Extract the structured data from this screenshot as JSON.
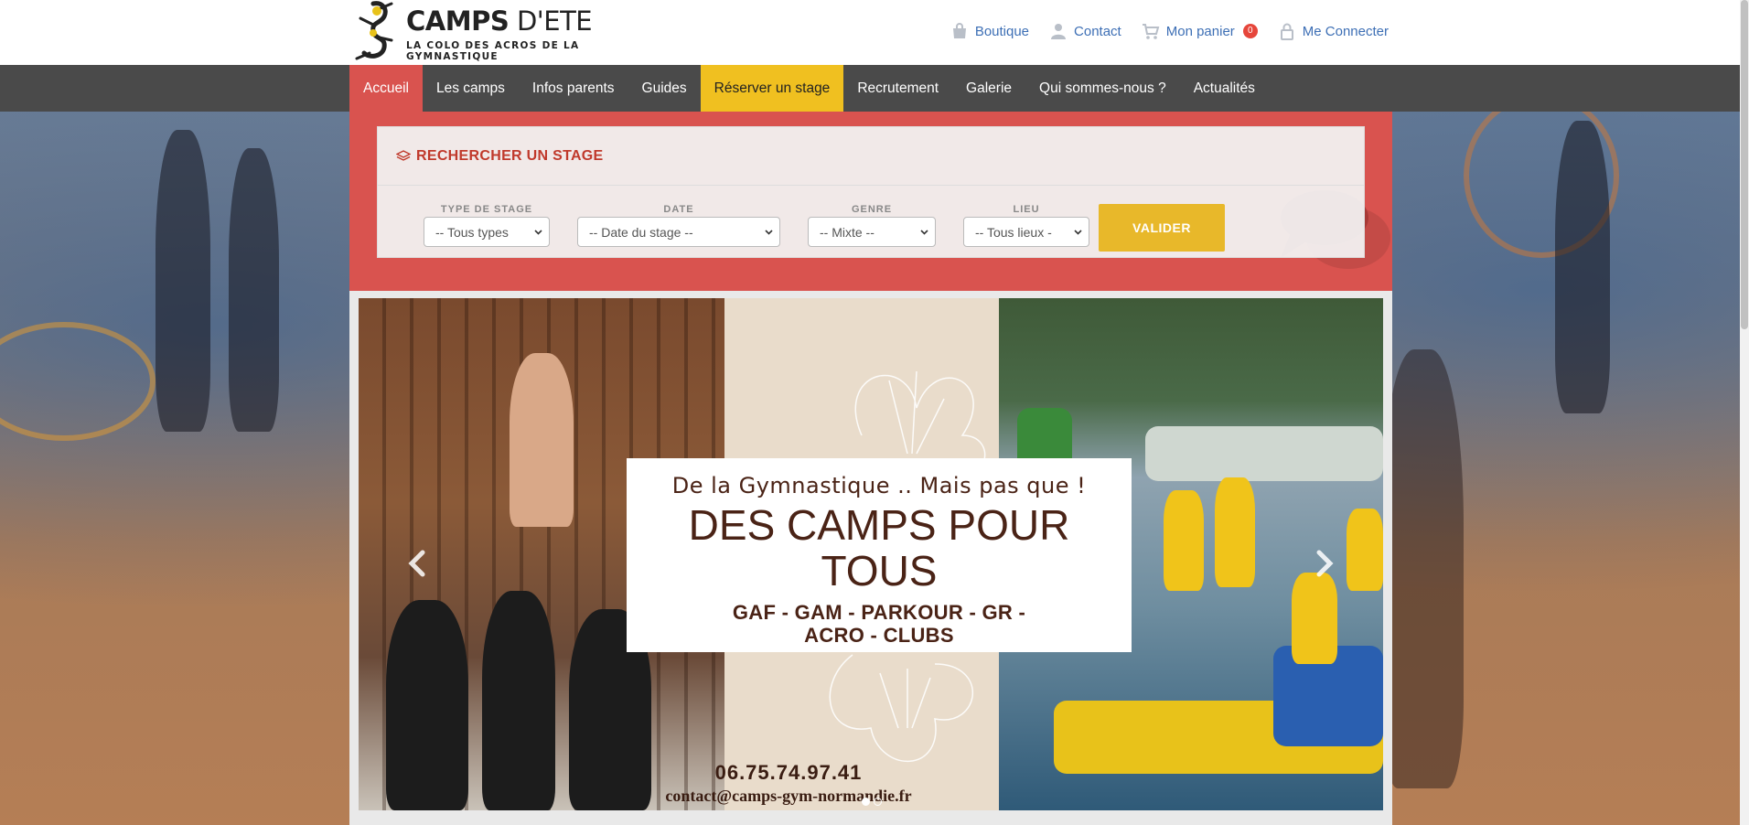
{
  "brand": {
    "title_bold": "CAMPS",
    "title_light": " D'ETE",
    "subtitle": "LA COLO DES ACROS DE LA GYMNASTIQUE"
  },
  "top_links": {
    "boutique": "Boutique",
    "contact": "Contact",
    "cart": "Mon panier",
    "cart_count": "0",
    "login": "Me Connecter"
  },
  "nav": {
    "items": [
      "Accueil",
      "Les camps",
      "Infos parents",
      "Guides",
      "Réserver un stage",
      "Recrutement",
      "Galerie",
      "Qui sommes-nous ?",
      "Actualités"
    ]
  },
  "search": {
    "title": "RECHERCHER UN STAGE",
    "filters": [
      {
        "label": "TYPE DE STAGE",
        "value": "-- Tous types"
      },
      {
        "label": "DATE",
        "value": "-- Date du stage --"
      },
      {
        "label": "GENRE",
        "value": "-- Mixte --"
      },
      {
        "label": "LIEU",
        "value": "-- Tous lieux -"
      }
    ],
    "submit": "VALIDER"
  },
  "slide": {
    "tagline": "De la Gymnastique .. Mais pas que !",
    "title_line1": "DES CAMPS POUR",
    "title_line2": "TOUS",
    "sub_line1": "GAF - GAM - PARKOUR - GR -",
    "sub_line2": "ACRO - CLUBS",
    "phone": "06.75.74.97.41",
    "email": "contact@camps-gym-normandie.fr"
  },
  "colors": {
    "nav_bg": "#4a4a4a",
    "nav_active": "#d9534f",
    "nav_highlight": "#f0c020",
    "link": "#3d6fb5",
    "search_bg": "#d9534f",
    "button": "#e8b82a"
  }
}
